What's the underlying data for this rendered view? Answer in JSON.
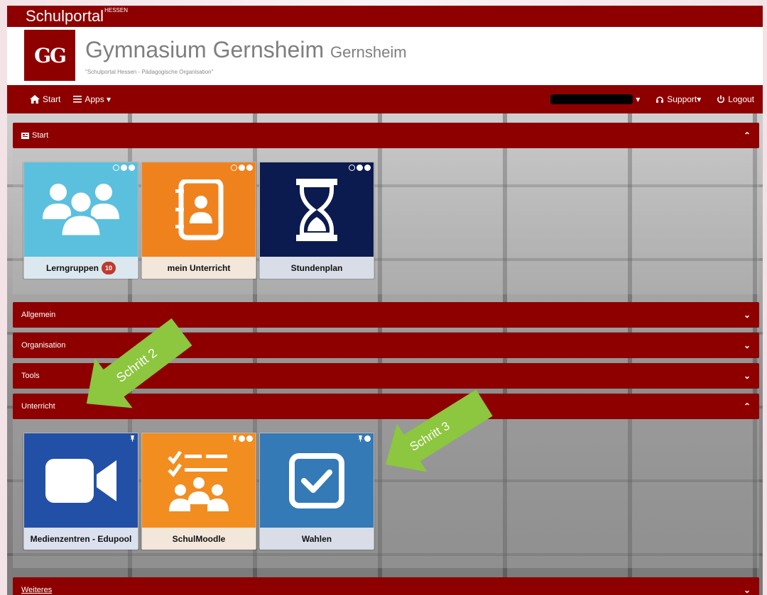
{
  "brand": {
    "name": "Schulportal",
    "superscript": "HESSEN"
  },
  "school": {
    "logo_text": "GG",
    "name": "Gymnasium Gernsheim",
    "city": "Gernsheim",
    "subtitle": "\"Schulportal Hessen - Pädagogische Organisation\""
  },
  "nav": {
    "start": "Start",
    "apps": "Apps",
    "support": "Support",
    "logout": "Logout"
  },
  "panels": {
    "start": "Start",
    "allgemein": "Allgemein",
    "organisation": "Organisation",
    "tools": "Tools",
    "unterricht": "Unterricht",
    "weiteres": "Weiteres"
  },
  "tiles_start": [
    {
      "label": "Lerngruppen",
      "badge": "10",
      "color": "#5bc0de"
    },
    {
      "label": "mein Unterricht",
      "color": "#f0821e"
    },
    {
      "label": "Stundenplan",
      "color": "#0b1b4f"
    }
  ],
  "tiles_unterricht": [
    {
      "label": "Medienzentren - Edupool",
      "color": "#2250a6"
    },
    {
      "label": "SchulMoodle",
      "color": "#f28d1f"
    },
    {
      "label": "Wahlen",
      "color": "#337ab7"
    }
  ],
  "annotations": {
    "step2": "Schritt 2",
    "step3": "Schritt 3",
    "color": "#8dc63f"
  },
  "colors": {
    "accent": "#8e0000"
  }
}
